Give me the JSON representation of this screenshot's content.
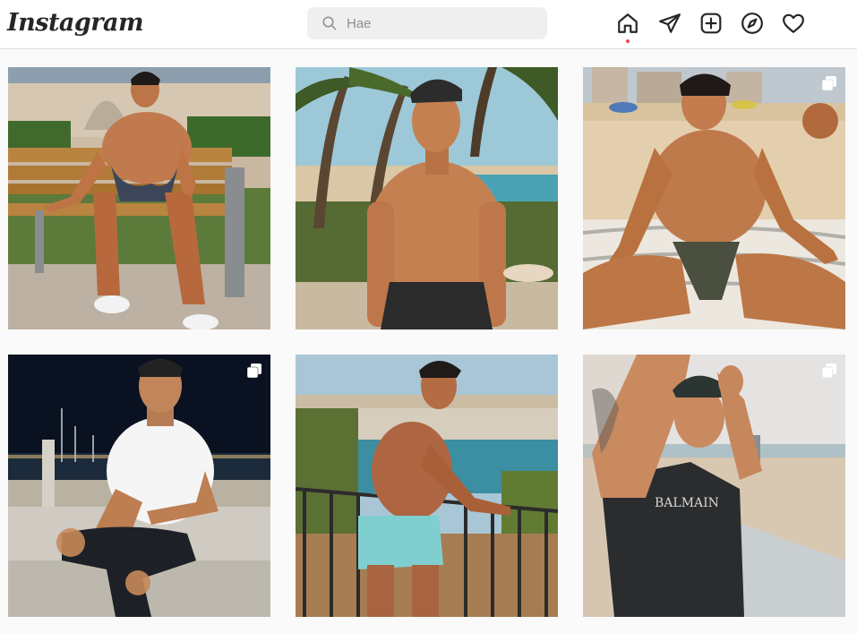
{
  "app": {
    "logo_text": "Instagram"
  },
  "search": {
    "placeholder": "Hae",
    "value": ""
  },
  "nav": {
    "icons": [
      "home-icon",
      "direct-icon",
      "new-post-icon",
      "explore-icon",
      "activity-icon"
    ],
    "active": "home-icon"
  },
  "colors": {
    "accent_dot": "#ed4956",
    "text": "#262626",
    "search_bg": "#efefef",
    "page_bg": "#fafafa"
  },
  "posts": [
    {
      "scene": "man-on-bench",
      "multiple": false
    },
    {
      "scene": "man-at-beach-palms",
      "multiple": false
    },
    {
      "scene": "man-sitting-on-beach-towel",
      "multiple": true
    },
    {
      "scene": "man-white-tshirt-night",
      "multiple": true
    },
    {
      "scene": "man-at-railing-coast",
      "multiple": false
    },
    {
      "scene": "man-black-tshirt-promenade",
      "multiple": true,
      "shirt_text": "BALMAIN"
    }
  ]
}
